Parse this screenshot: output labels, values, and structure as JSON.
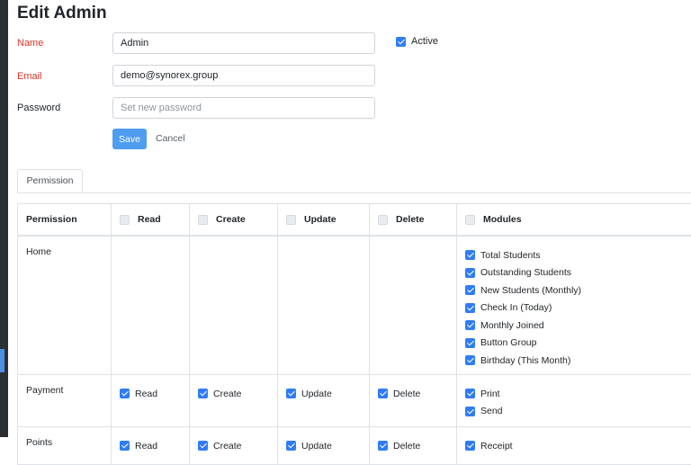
{
  "page_title": "Edit Admin",
  "form": {
    "name_label": "Name",
    "name_value": "Admin",
    "email_label": "Email",
    "email_value": "demo@synorex.group",
    "password_label": "Password",
    "password_placeholder": "Set new password",
    "active_label": "Active",
    "active_checked": true,
    "save_label": "Save",
    "cancel_label": "Cancel"
  },
  "tabs": [
    "Permission"
  ],
  "permission_table": {
    "headers": [
      "Permission",
      "Read",
      "Create",
      "Update",
      "Delete",
      "Modules"
    ],
    "rows": [
      {
        "name": "Home",
        "read": null,
        "create": null,
        "update": null,
        "delete": null,
        "modules": [
          "Total Students",
          "Outstanding Students",
          "New Students (Monthly)",
          "Check In (Today)",
          "Monthly Joined",
          "Button Group",
          "Birthday (This Month)"
        ]
      },
      {
        "name": "Payment",
        "read": "Read",
        "create": "Create",
        "update": "Update",
        "delete": "Delete",
        "modules": [
          "Print",
          "Send"
        ]
      },
      {
        "name": "Points",
        "read": "Read",
        "create": "Create",
        "update": "Update",
        "delete": "Delete",
        "modules": [
          "Receipt"
        ]
      }
    ]
  },
  "colors": {
    "accent": "#2f7cf6",
    "required_label": "#d9342b",
    "save_button": "#4f9df0"
  }
}
